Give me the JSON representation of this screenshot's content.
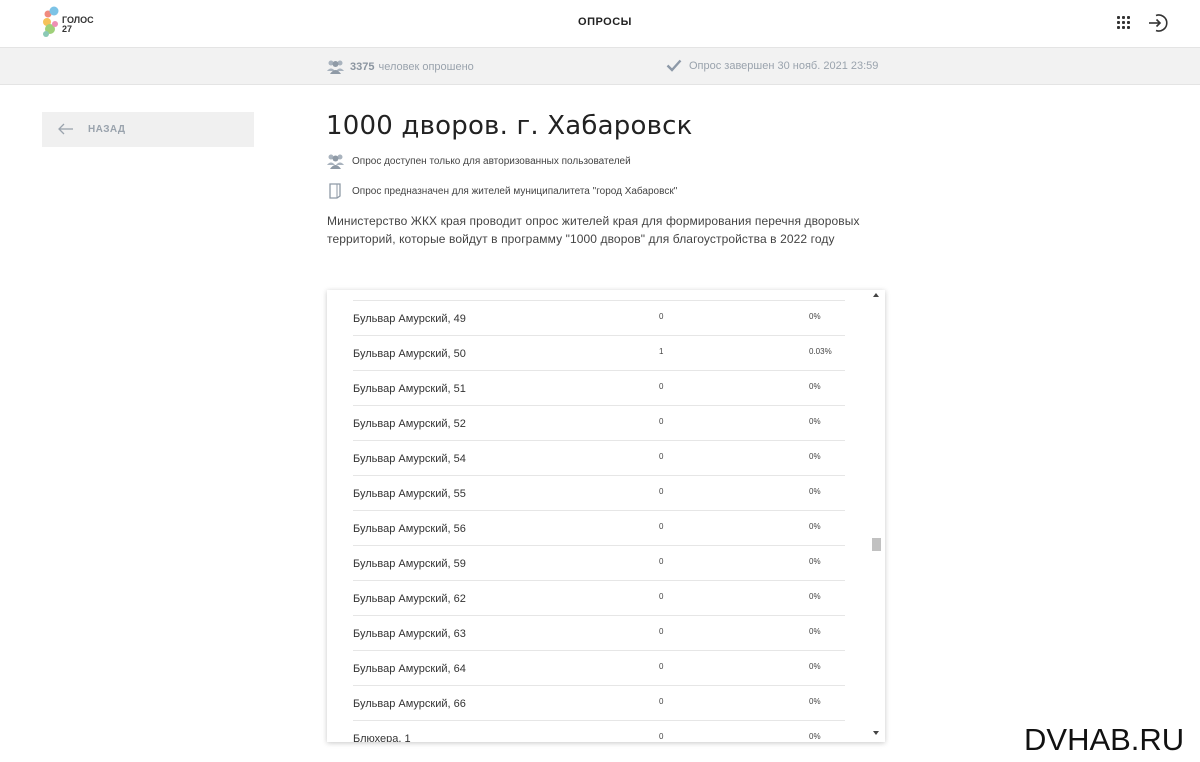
{
  "header": {
    "logo_line1": "ГОЛОС",
    "logo_line2": "27",
    "title": "ОПРОСЫ",
    "apps_icon": "grid-icon",
    "logout_icon": "logout-icon"
  },
  "status": {
    "respondents_count": "3375",
    "respondents_label": "человек опрошено",
    "completed_label": "Опрос завершен 30 нояб. 2021 23:59"
  },
  "back": {
    "label": "НАЗАД"
  },
  "survey": {
    "title": "1000 дворов. г. Хабаровск",
    "note_auth": "Опрос доступен только для авторизованных пользователей",
    "note_municipality": "Опрос предназначен для жителей муниципалитета \"город Хабаровск\"",
    "description": "Министерство ЖКХ края проводит опрос жителей края для формирования перечня дворовых территорий, которые войдут в программу \"1000 дворов\" для благоустройства в 2022 году"
  },
  "results": {
    "rows": [
      {
        "address": "Бульвар Амурский, 49",
        "count": "0",
        "percent": "0%"
      },
      {
        "address": "Бульвар Амурский, 50",
        "count": "1",
        "percent": "0.03%"
      },
      {
        "address": "Бульвар Амурский, 51",
        "count": "0",
        "percent": "0%"
      },
      {
        "address": "Бульвар Амурский, 52",
        "count": "0",
        "percent": "0%"
      },
      {
        "address": "Бульвар Амурский, 54",
        "count": "0",
        "percent": "0%"
      },
      {
        "address": "Бульвар Амурский, 55",
        "count": "0",
        "percent": "0%"
      },
      {
        "address": "Бульвар Амурский, 56",
        "count": "0",
        "percent": "0%"
      },
      {
        "address": "Бульвар Амурский, 59",
        "count": "0",
        "percent": "0%"
      },
      {
        "address": "Бульвар Амурский, 62",
        "count": "0",
        "percent": "0%"
      },
      {
        "address": "Бульвар Амурский, 63",
        "count": "0",
        "percent": "0%"
      },
      {
        "address": "Бульвар Амурский, 64",
        "count": "0",
        "percent": "0%"
      },
      {
        "address": "Бульвар Амурский, 66",
        "count": "0",
        "percent": "0%"
      },
      {
        "address": "Блюхера, 1",
        "count": "0",
        "percent": "0%"
      }
    ]
  },
  "watermark": "DVHAB.RU",
  "colors": {
    "strip_bg": "#f2f2f2",
    "muted_text": "#9aa3ad",
    "accent_check": "#8d99a8"
  }
}
